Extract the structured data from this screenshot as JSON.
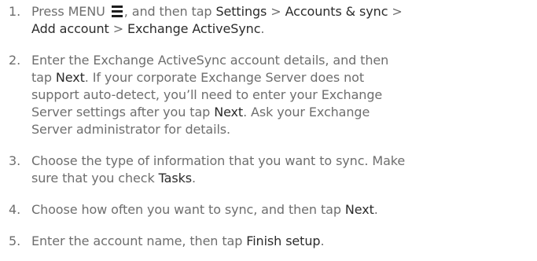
{
  "steps": [
    {
      "number": "1.",
      "lines": [
        [
          {
            "t": "Press MENU ",
            "b": false
          },
          {
            "icon": "menu-icon"
          },
          {
            "t": ", and then tap ",
            "b": false
          },
          {
            "t": "Settings",
            "b": true
          },
          {
            "t": " > ",
            "b": false
          },
          {
            "t": "Accounts & sync",
            "b": true
          },
          {
            "t": " >",
            "b": false
          }
        ],
        [
          {
            "t": "Add account",
            "b": true
          },
          {
            "t": " > ",
            "b": false
          },
          {
            "t": "Exchange ActiveSync",
            "b": true
          },
          {
            "t": ".",
            "b": false
          }
        ]
      ]
    },
    {
      "number": "2.",
      "lines": [
        [
          {
            "t": "Enter the Exchange ActiveSync account details, and then",
            "b": false
          }
        ],
        [
          {
            "t": "tap ",
            "b": false
          },
          {
            "t": "Next",
            "b": true
          },
          {
            "t": ". If your corporate Exchange Server does not",
            "b": false
          }
        ],
        [
          {
            "t": "support auto-detect, you’ll need to enter your Exchange",
            "b": false
          }
        ],
        [
          {
            "t": "Server settings after you tap ",
            "b": false
          },
          {
            "t": "Next",
            "b": true
          },
          {
            "t": ". Ask your Exchange",
            "b": false
          }
        ],
        [
          {
            "t": "Server administrator for details.",
            "b": false
          }
        ]
      ]
    },
    {
      "number": "3.",
      "lines": [
        [
          {
            "t": "Choose the type of information that you want to sync. Make",
            "b": false
          }
        ],
        [
          {
            "t": "sure that you check ",
            "b": false
          },
          {
            "t": "Tasks",
            "b": true
          },
          {
            "t": ".",
            "b": false
          }
        ]
      ]
    },
    {
      "number": "4.",
      "lines": [
        [
          {
            "t": "Choose how often you want to sync, and then tap ",
            "b": false
          },
          {
            "t": "Next",
            "b": true
          },
          {
            "t": ".",
            "b": false
          }
        ]
      ]
    },
    {
      "number": "5.",
      "lines": [
        [
          {
            "t": "Enter the account name, then tap ",
            "b": false
          },
          {
            "t": "Finish setup",
            "b": true
          },
          {
            "t": ".",
            "b": false
          }
        ]
      ]
    }
  ]
}
